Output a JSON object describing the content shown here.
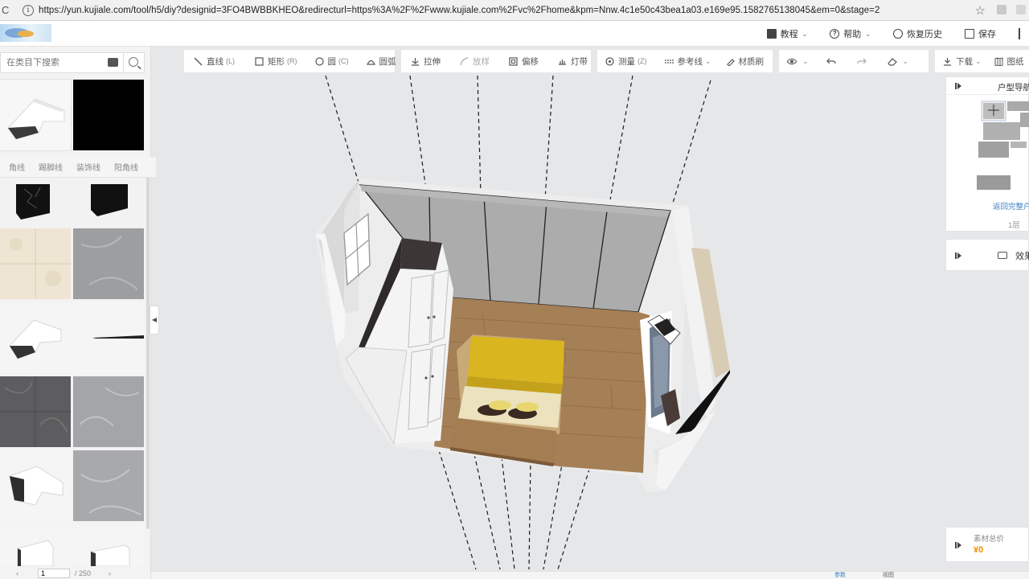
{
  "browser": {
    "url": "https://yun.kujiale.com/tool/h5/diy?designid=3FO4BWBBKHEO&redirecturl=https%3A%2F%2Fwww.kujiale.com%2Fvc%2Fhome&kpm=Nnw.4c1e50c43bea1a03.e169e95.1582765138045&em=0&stage=2",
    "reload_icon": "reload-icon",
    "star_icon": "bookmark-star-icon"
  },
  "header": {
    "menu": [
      {
        "label": "教程",
        "icon": "book-icon",
        "dropdown": true
      },
      {
        "label": "帮助",
        "icon": "help-icon",
        "dropdown": true
      },
      {
        "label": "恢复历史",
        "icon": "history-icon",
        "dropdown": false
      },
      {
        "label": "保存",
        "icon": "save-icon",
        "dropdown": false
      }
    ]
  },
  "left_panel": {
    "search_placeholder": "在类目下搜索",
    "category_tabs": [
      "角线",
      "踢脚线",
      "装饰线",
      "阳角线"
    ],
    "pager": {
      "current": "1",
      "total": "/ 250",
      "prev": "‹",
      "next": "›"
    }
  },
  "toolbar": {
    "groups": [
      [
        {
          "label": "直线",
          "key": "(L)",
          "icon": "line-icon"
        },
        {
          "label": "矩形",
          "key": "(R)",
          "icon": "rectangle-icon"
        },
        {
          "label": "圆",
          "key": "(C)",
          "icon": "circle-icon"
        },
        {
          "label": "圆弧",
          "key": "",
          "icon": "arc-icon"
        }
      ],
      [
        {
          "label": "拉伸",
          "key": "",
          "icon": "extrude-icon"
        },
        {
          "label": "放样",
          "key": "",
          "icon": "loft-icon",
          "disabled": true
        },
        {
          "label": "偏移",
          "key": "",
          "icon": "offset-icon"
        },
        {
          "label": "灯带",
          "key": "",
          "icon": "light-strip-icon"
        }
      ],
      [
        {
          "label": "测量",
          "key": "(Z)",
          "icon": "measure-icon"
        },
        {
          "label": "参考线",
          "key": "",
          "icon": "guide-line-icon"
        },
        {
          "label": "材质刷",
          "key": "",
          "icon": "material-brush-icon"
        }
      ],
      [
        {
          "label": "",
          "key": "",
          "icon": "eye-icon"
        },
        {
          "label": "",
          "key": "",
          "icon": "undo-icon"
        },
        {
          "label": "",
          "key": "",
          "icon": "redo-icon"
        },
        {
          "label": "",
          "key": "",
          "icon": "eraser-icon"
        }
      ],
      [
        {
          "label": "下载",
          "key": "",
          "icon": "download-icon"
        },
        {
          "label": "图纸",
          "key": "",
          "icon": "drawings-icon"
        }
      ]
    ]
  },
  "nav_panel": {
    "title": "户型导航",
    "back_link": "返回完整户型",
    "floor": "1层"
  },
  "effect_panel": {
    "label": "效果"
  },
  "price_panel": {
    "label": "素材总价",
    "value": "¥0"
  },
  "status_bar": {
    "items": [
      "参数",
      "视图"
    ]
  },
  "colors": {
    "accent_blue": "#3b82c4",
    "price_orange": "#f08c00",
    "canvas_bg": "#e6e7e9",
    "bed_yellow": "#d9b520",
    "floor_wood": "#a57f56"
  }
}
